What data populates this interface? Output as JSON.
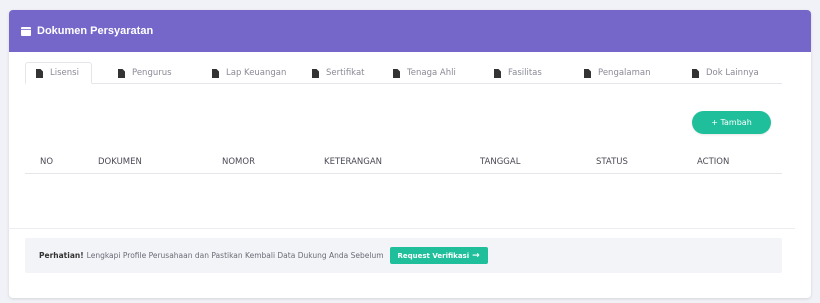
{
  "card": {
    "title": "Dokumen Persyaratan",
    "title_icon": "list-card-icon"
  },
  "tabs": [
    {
      "label": "Lisensi",
      "icon": "document-icon",
      "active": true
    },
    {
      "label": "Pengurus",
      "icon": "document-icon",
      "active": false
    },
    {
      "label": "Lap Keuangan",
      "icon": "document-icon",
      "active": false
    },
    {
      "label": "Sertifikat",
      "icon": "document-icon",
      "active": false
    },
    {
      "label": "Tenaga Ahli",
      "icon": "document-icon",
      "active": false
    },
    {
      "label": "Fasilitas",
      "icon": "document-icon",
      "active": false
    },
    {
      "label": "Pengalaman",
      "icon": "document-icon",
      "active": false
    },
    {
      "label": "Dok Lainnya",
      "icon": "document-icon",
      "active": false
    }
  ],
  "add_button": {
    "label": "+ Tambah"
  },
  "table": {
    "columns": [
      "NO",
      "DOKUMEN",
      "NOMOR",
      "KETERANGAN",
      "TANGGAL",
      "STATUS",
      "ACTION"
    ],
    "rows": []
  },
  "notice": {
    "bold": "Perhatian!",
    "text": "Lengkapi Profile Perusahaan dan Pastikan Kembali Data Dukung Anda Sebelum",
    "button_label": "Request Verifikasi",
    "button_arrow": "→"
  },
  "colors": {
    "header_bg": "#7467c9",
    "accent": "#1fbf9b"
  }
}
